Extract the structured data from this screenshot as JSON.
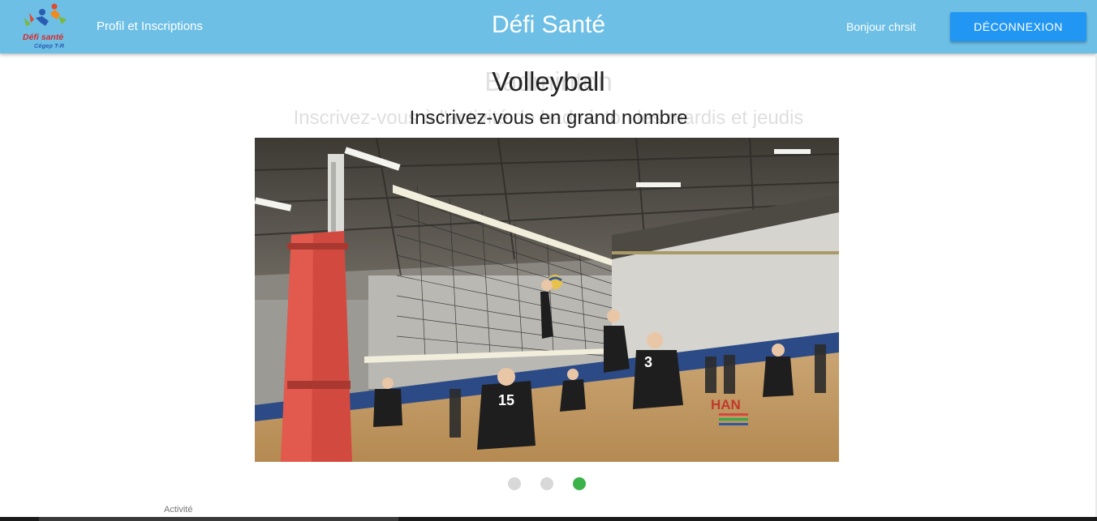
{
  "header": {
    "logo_text_line1": "Défi santé",
    "logo_text_line2": "Cégep T-R",
    "nav_profile": "Profil et Inscriptions",
    "site_title": "Défi Santé",
    "greeting": "Bonjour chrsit",
    "logout_label": "DÉCONNEXION"
  },
  "carousel": {
    "title": "Volleyball",
    "subtitle": "Inscrivez-vous en grand nombre",
    "prev_title": "Badminton",
    "prev_subtitle": "Inscrivez-vous à l'activité de badminton les mardis et jeudis",
    "slide_count": 3,
    "active_index": 2,
    "watermark_text": "HAN"
  },
  "footer": {
    "label": "Activité"
  },
  "colors": {
    "header_bg": "#6dbfe6",
    "button_bg": "#2196f3",
    "dot_active": "#3cb34a",
    "dot_inactive": "#d8d8d8"
  }
}
